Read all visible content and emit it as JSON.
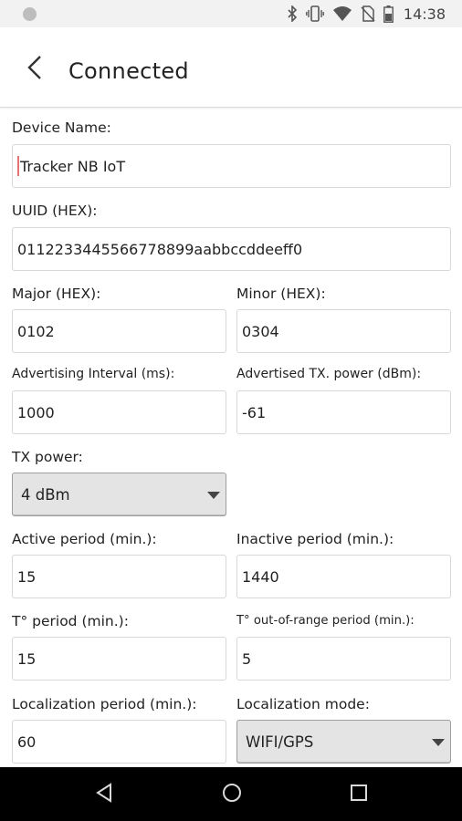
{
  "status_bar": {
    "time": "14:38",
    "icons": [
      "bluetooth-icon",
      "vibrate-icon",
      "wifi-icon",
      "no-sim-icon",
      "battery-icon"
    ]
  },
  "app_bar": {
    "title": "Connected",
    "back_icon": "back-arrow-icon"
  },
  "form": {
    "device_name": {
      "label": "Device Name:",
      "value": "Tracker NB IoT"
    },
    "uuid": {
      "label": "UUID (HEX):",
      "value": "0112233445566778899aabbccddeeff0"
    },
    "major": {
      "label": "Major (HEX):",
      "value": "0102"
    },
    "minor": {
      "label": "Minor (HEX):",
      "value": "0304"
    },
    "adv_interval": {
      "label": "Advertising Interval (ms):",
      "value": "1000"
    },
    "adv_tx_power": {
      "label": "Advertised TX. power (dBm):",
      "value": "-61"
    },
    "tx_power": {
      "label": "TX power:",
      "value": "4 dBm"
    },
    "active_period": {
      "label": "Active period (min.):",
      "value": "15"
    },
    "inactive_period": {
      "label": "Inactive period (min.):",
      "value": "1440"
    },
    "temp_period": {
      "label": "T° period (min.):",
      "value": "15"
    },
    "temp_out_of_range_period": {
      "label": "T° out-of-range period (min.):",
      "value": "5"
    },
    "localization_period": {
      "label": "Localization period (min.):",
      "value": "60"
    },
    "localization_mode": {
      "label": "Localization mode:",
      "value": "WIFI/GPS"
    }
  },
  "nav_bar": {
    "icons": [
      "nav-back-icon",
      "nav-home-icon",
      "nav-recents-icon"
    ]
  }
}
